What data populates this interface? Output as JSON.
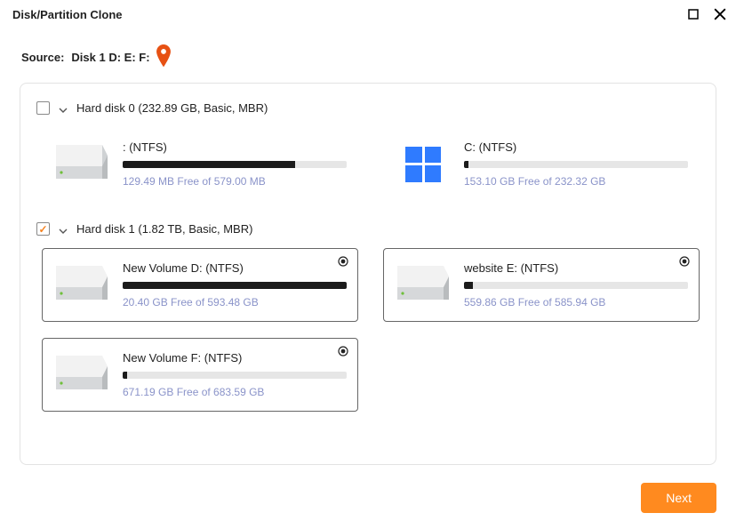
{
  "window": {
    "title": "Disk/Partition Clone"
  },
  "source": {
    "label": "Source:",
    "value": "Disk 1 D: E: F:"
  },
  "disks": [
    {
      "checked": false,
      "label": "Hard disk 0 (232.89 GB, Basic, MBR)",
      "partitions": [
        {
          "title": " : (NTFS)",
          "free": "129.49 MB Free of 579.00 MB",
          "fill_pct": 77,
          "icon": "drive",
          "selected": false
        },
        {
          "title": "C: (NTFS)",
          "free": "153.10 GB Free of 232.32 GB",
          "fill_pct": 2,
          "icon": "windows",
          "selected": false
        }
      ]
    },
    {
      "checked": true,
      "label": "Hard disk 1 (1.82 TB, Basic, MBR)",
      "partitions": [
        {
          "title": "New Volume D: (NTFS)",
          "free": "20.40 GB Free of 593.48 GB",
          "fill_pct": 100,
          "icon": "drive",
          "selected": true
        },
        {
          "title": "website E: (NTFS)",
          "free": "559.86 GB Free of 585.94 GB",
          "fill_pct": 4,
          "icon": "drive",
          "selected": true
        },
        {
          "title": "New Volume F: (NTFS)",
          "free": "671.19 GB Free of 683.59 GB",
          "fill_pct": 2,
          "icon": "drive",
          "selected": true
        }
      ]
    }
  ],
  "buttons": {
    "next": "Next"
  },
  "colors": {
    "accent": "#ff8a1f",
    "pin": "#e75113"
  }
}
